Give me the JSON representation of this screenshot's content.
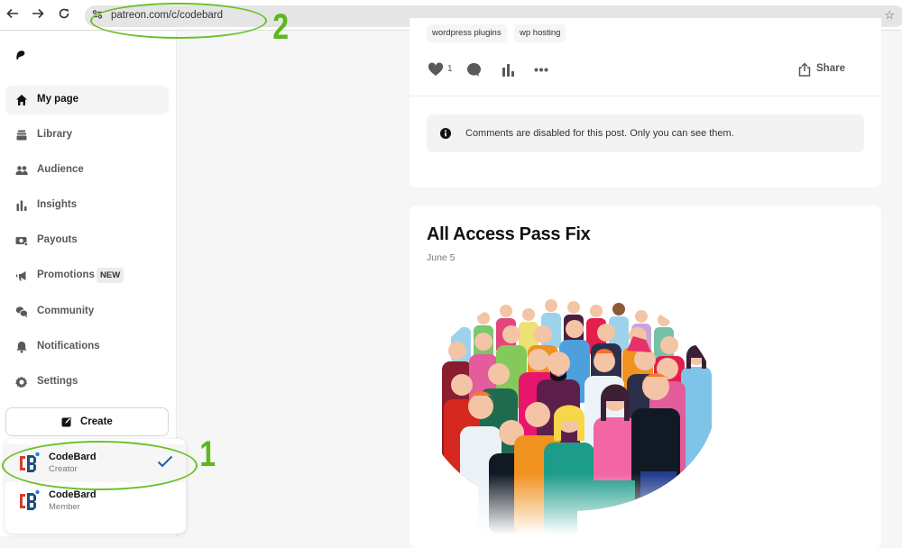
{
  "browser": {
    "back_icon": "arrow-left",
    "forward_icon": "arrow-right",
    "reload_icon": "reload",
    "site_info_icon": "tune",
    "url": "patreon.com/c/codebard",
    "bookmark_icon": "star"
  },
  "sidebar": {
    "logo": "patreon-logo",
    "items": [
      {
        "label": "My page",
        "icon": "home",
        "active": true
      },
      {
        "label": "Library",
        "icon": "library"
      },
      {
        "label": "Audience",
        "icon": "people"
      },
      {
        "label": "Insights",
        "icon": "bar-chart"
      },
      {
        "label": "Payouts",
        "icon": "money"
      },
      {
        "label": "Promotions",
        "icon": "megaphone",
        "badge": "NEW"
      },
      {
        "label": "Community",
        "icon": "chat-bubbles"
      },
      {
        "label": "Notifications",
        "icon": "bell"
      },
      {
        "label": "Settings",
        "icon": "gear"
      }
    ],
    "create_label": "Create",
    "accounts": [
      {
        "name": "CodeBard",
        "role": "Creator",
        "selected": true
      },
      {
        "name": "CodeBard",
        "role": "Member",
        "selected": false
      }
    ]
  },
  "post1": {
    "tags": [
      "wordpress plugins",
      "wp hosting"
    ],
    "like_count": "1",
    "share_label": "Share",
    "comments_notice": "Comments are disabled for this post. Only you can see them."
  },
  "post2": {
    "title": "All Access Pass Fix",
    "date": "June 5",
    "image": "crowd-of-people-illustration"
  },
  "annotations": {
    "one": "1",
    "two": "2",
    "color": "#5cb81c"
  }
}
